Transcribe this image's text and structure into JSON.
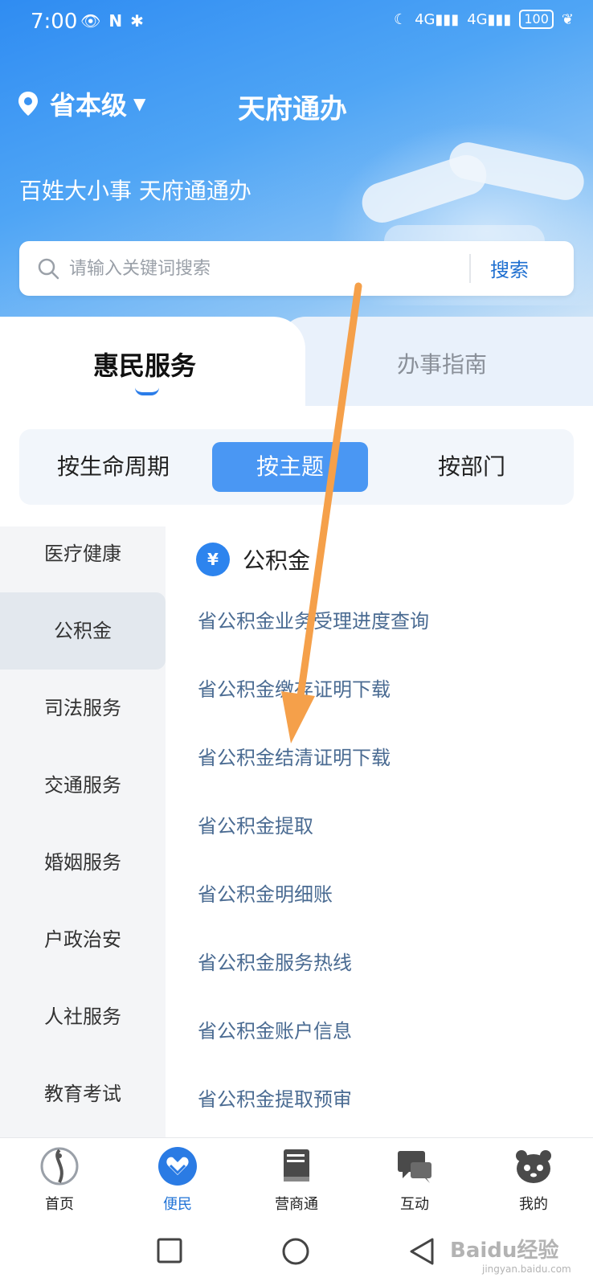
{
  "status_bar": {
    "time": "7:00",
    "left_icons": [
      "eye-icon",
      "nfc-icon",
      "bluetooth-icon"
    ],
    "right_icons": [
      "moon-icon",
      "signal-4g-icon",
      "signal-4g-icon",
      "leaf-icon"
    ],
    "network_1": "4G",
    "network_2": "4G",
    "battery": "100"
  },
  "header": {
    "location": "省本级",
    "title": "天府通办",
    "slogan": "百姓大小事 天府通通办",
    "background_color": "#3a93f3"
  },
  "search": {
    "placeholder": "请输入关键词搜索",
    "button": "搜索"
  },
  "main_tabs": [
    {
      "label": "惠民服务",
      "active": true
    },
    {
      "label": "办事指南",
      "active": false
    }
  ],
  "segments": [
    {
      "label": "按生命周期",
      "active": false
    },
    {
      "label": "按主题",
      "active": true
    },
    {
      "label": "按部门",
      "active": false
    }
  ],
  "categories": [
    {
      "label": "医疗健康",
      "active": false
    },
    {
      "label": "公积金",
      "active": true
    },
    {
      "label": "司法服务",
      "active": false
    },
    {
      "label": "交通服务",
      "active": false
    },
    {
      "label": "婚姻服务",
      "active": false
    },
    {
      "label": "户政治安",
      "active": false
    },
    {
      "label": "人社服务",
      "active": false
    },
    {
      "label": "教育考试",
      "active": false
    }
  ],
  "section": {
    "icon": "yuan-house-icon",
    "icon_glyph": "¥",
    "title": "公积金"
  },
  "services": [
    "省公积金业务受理进度查询",
    "省公积金缴存证明下载",
    "省公积金结清证明下载",
    "省公积金提取",
    "省公积金明细账",
    "省公积金服务热线",
    "省公积金账户信息",
    "省公积金提取预审"
  ],
  "bottom_nav": [
    {
      "label": "首页",
      "icon": "home-logo-icon",
      "active": false
    },
    {
      "label": "便民",
      "icon": "heart-service-icon",
      "active": true
    },
    {
      "label": "营商通",
      "icon": "book-icon",
      "active": false
    },
    {
      "label": "互动",
      "icon": "chat-icon",
      "active": false
    },
    {
      "label": "我的",
      "icon": "panda-icon",
      "active": false
    }
  ],
  "watermark": {
    "text": "Baidu经验",
    "sub": "jingyan.baidu.com"
  },
  "colors": {
    "accent": "#2b7de9",
    "active_segment": "#4a97f3",
    "link": "#4a6b92",
    "annotation_arrow": "#f5a04a"
  }
}
